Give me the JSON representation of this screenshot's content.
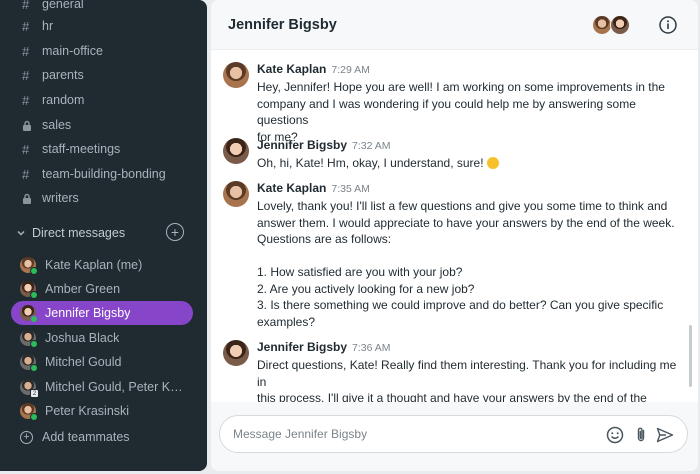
{
  "sidebar": {
    "channels": [
      {
        "name": "general",
        "private": false
      },
      {
        "name": "hr",
        "private": false
      },
      {
        "name": "main-office",
        "private": false
      },
      {
        "name": "parents",
        "private": false
      },
      {
        "name": "random",
        "private": false
      },
      {
        "name": "sales",
        "private": true
      },
      {
        "name": "staff-meetings",
        "private": false
      },
      {
        "name": "team-building-bonding",
        "private": false
      },
      {
        "name": "writers",
        "private": true
      }
    ],
    "dm_header": "Direct messages",
    "dms": [
      {
        "name": "Kate Kaplan (me)"
      },
      {
        "name": "Amber Green"
      },
      {
        "name": "Jennifer Bigsby",
        "active": true
      },
      {
        "name": "Joshua Black"
      },
      {
        "name": "Mitchel Gould"
      },
      {
        "name": "Mitchel Gould, Peter Kra…",
        "group": true
      },
      {
        "name": "Peter Krasinski"
      }
    ],
    "add_teammates": "Add teammates"
  },
  "chat": {
    "title": "Jennifer Bigsby",
    "messages": [
      {
        "author": "Kate Kaplan",
        "time": "7:29 AM",
        "lines": [
          "Hey, Jennifer! Hope you are well! I am working on some improvements in the",
          "company and I was wondering if you could help me by answering some questions",
          "for me?"
        ]
      },
      {
        "author": "Jennifer Bigsby",
        "time": "7:32 AM",
        "lines": [
          "Oh, hi, Kate! Hm, okay, I understand, sure!"
        ]
      },
      {
        "author": "Kate Kaplan",
        "time": "7:35 AM",
        "lines": [
          "Lovely, thank you! I'll list a few questions and give you some time to think and",
          "answer them. I would appreciate to have your answers by the end of the week.",
          "Questions are as follows:",
          "",
          "1. How satisfied are you with your job?",
          "2. Are you actively looking for a new job?",
          "3. Is there something we could improve and do better? Can you give specific",
          "examples?"
        ]
      },
      {
        "author": "Jennifer Bigsby",
        "time": "7:36 AM",
        "lines": [
          "Direct questions, Kate! Really find them interesting. Thank you for including me in",
          "this process, I'll give it a thought and have your answers by the end of the week!"
        ]
      }
    ],
    "composer": {
      "placeholder": "Message Jennifer Bigsby",
      "value": ""
    }
  },
  "colors": {
    "sidebar_bg": "#1f2a31",
    "active_item": "#8746c9",
    "online_status": "#2bbd5a",
    "emoji": "#f7c12b"
  },
  "icons": {
    "channel": "hash-icon",
    "private_channel": "lock-icon",
    "dm_toggle": "chevron-down-icon",
    "new_dm": "plus-circle-icon",
    "add_teammates": "plus-circle-icon",
    "info": "info-icon",
    "emoji": "emoji-icon",
    "attach": "paperclip-icon",
    "send": "send-icon"
  }
}
